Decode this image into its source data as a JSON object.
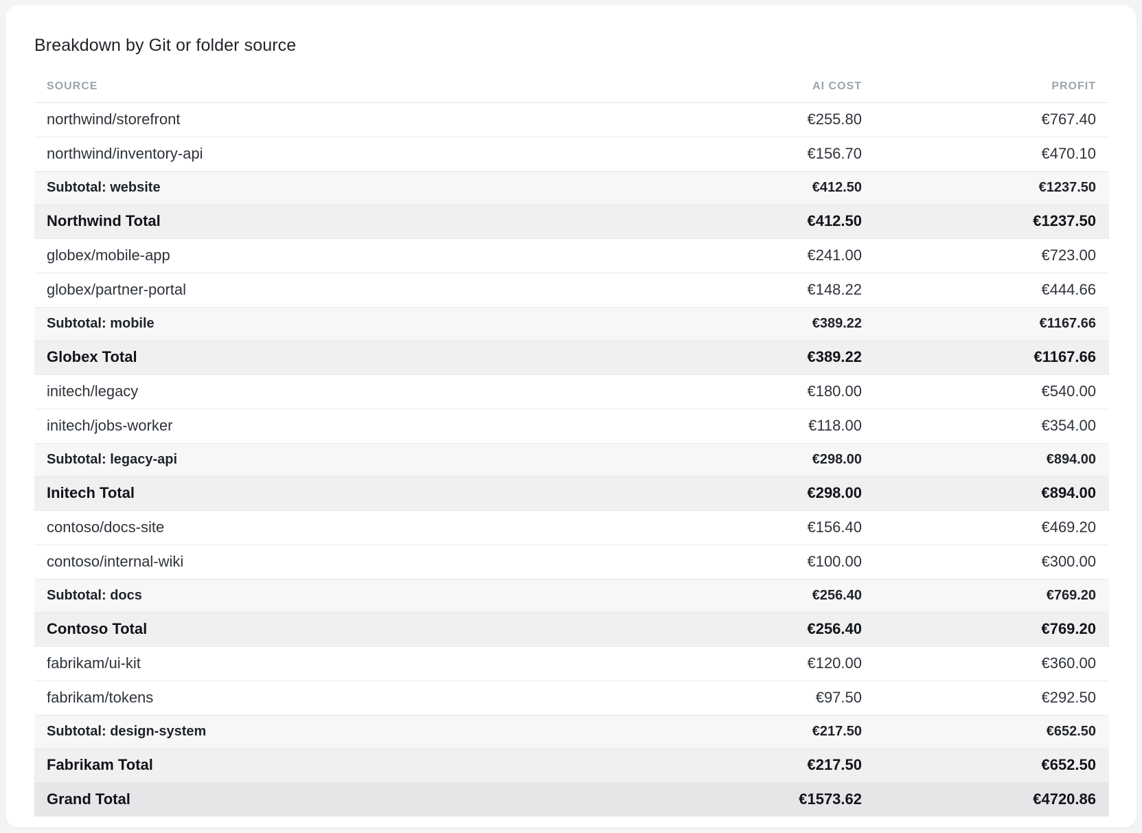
{
  "card": {
    "title": "Breakdown by Git or folder source"
  },
  "table": {
    "headers": {
      "source": "SOURCE",
      "ai_cost": "AI COST",
      "profit": "PROFIT"
    },
    "groups": [
      {
        "rows": [
          {
            "source": "northwind/storefront",
            "ai_cost": "€255.80",
            "profit": "€767.40"
          },
          {
            "source": "northwind/inventory-api",
            "ai_cost": "€156.70",
            "profit": "€470.10"
          }
        ],
        "subtotal": {
          "label": "Subtotal: website",
          "ai_cost": "€412.50",
          "profit": "€1237.50"
        },
        "total": {
          "label": "Northwind Total",
          "ai_cost": "€412.50",
          "profit": "€1237.50"
        }
      },
      {
        "rows": [
          {
            "source": "globex/mobile-app",
            "ai_cost": "€241.00",
            "profit": "€723.00"
          },
          {
            "source": "globex/partner-portal",
            "ai_cost": "€148.22",
            "profit": "€444.66"
          }
        ],
        "subtotal": {
          "label": "Subtotal: mobile",
          "ai_cost": "€389.22",
          "profit": "€1167.66"
        },
        "total": {
          "label": "Globex Total",
          "ai_cost": "€389.22",
          "profit": "€1167.66"
        }
      },
      {
        "rows": [
          {
            "source": "initech/legacy",
            "ai_cost": "€180.00",
            "profit": "€540.00"
          },
          {
            "source": "initech/jobs-worker",
            "ai_cost": "€118.00",
            "profit": "€354.00"
          }
        ],
        "subtotal": {
          "label": "Subtotal: legacy-api",
          "ai_cost": "€298.00",
          "profit": "€894.00"
        },
        "total": {
          "label": "Initech Total",
          "ai_cost": "€298.00",
          "profit": "€894.00"
        }
      },
      {
        "rows": [
          {
            "source": "contoso/docs-site",
            "ai_cost": "€156.40",
            "profit": "€469.20"
          },
          {
            "source": "contoso/internal-wiki",
            "ai_cost": "€100.00",
            "profit": "€300.00"
          }
        ],
        "subtotal": {
          "label": "Subtotal: docs",
          "ai_cost": "€256.40",
          "profit": "€769.20"
        },
        "total": {
          "label": "Contoso Total",
          "ai_cost": "€256.40",
          "profit": "€769.20"
        }
      },
      {
        "rows": [
          {
            "source": "fabrikam/ui-kit",
            "ai_cost": "€120.00",
            "profit": "€360.00"
          },
          {
            "source": "fabrikam/tokens",
            "ai_cost": "€97.50",
            "profit": "€292.50"
          }
        ],
        "subtotal": {
          "label": "Subtotal: design-system",
          "ai_cost": "€217.50",
          "profit": "€652.50"
        },
        "total": {
          "label": "Fabrikam Total",
          "ai_cost": "€217.50",
          "profit": "€652.50"
        }
      }
    ],
    "grand_total": {
      "label": "Grand Total",
      "ai_cost": "€1573.62",
      "profit": "€4720.86"
    }
  }
}
